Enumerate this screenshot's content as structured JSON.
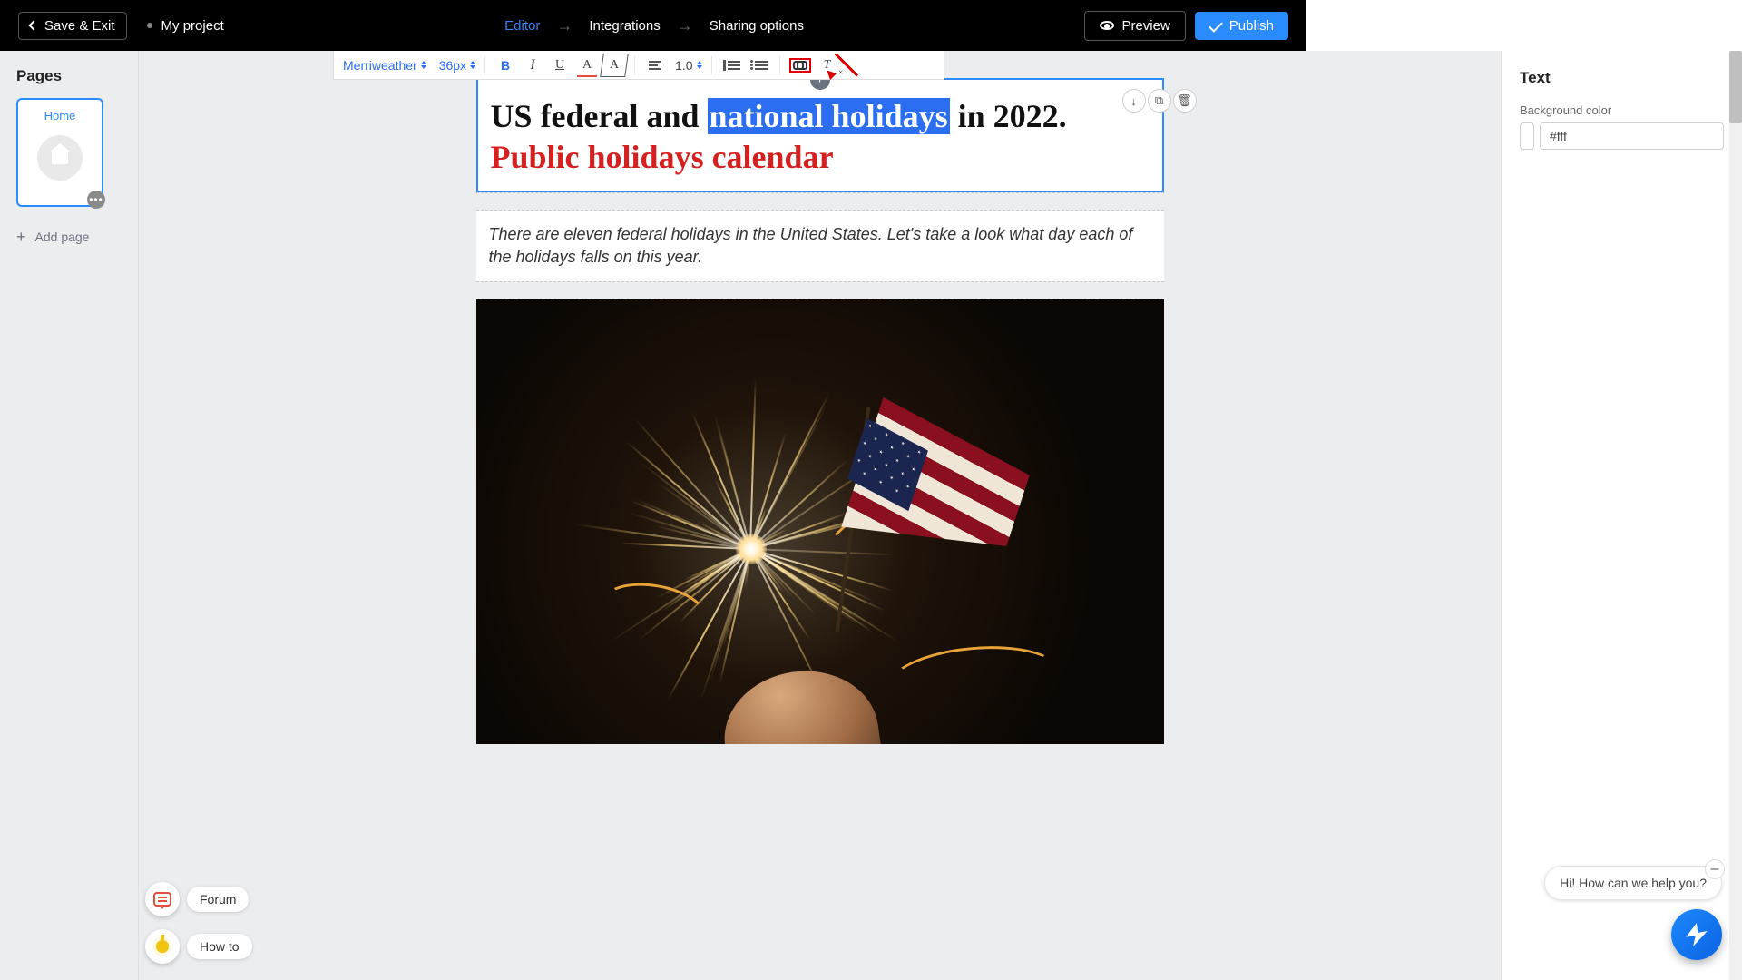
{
  "topbar": {
    "saveExit": "Save & Exit",
    "project": "My project",
    "nav": {
      "editor": "Editor",
      "integrations": "Integrations",
      "sharing": "Sharing options"
    },
    "preview": "Preview",
    "publish": "Publish"
  },
  "rtToolbar": {
    "font": "Merriweather",
    "size": "36px",
    "lineHeight": "1.0"
  },
  "leftbar": {
    "title": "Pages",
    "page0": "Home",
    "addPage": "Add page"
  },
  "content": {
    "h1_pre": "US federal and ",
    "h1_sel": "national holidays",
    "h1_post": " in 2022.",
    "h1_line2": "Public holidays calendar",
    "intro": "There are eleven federal holidays in the United States. Let's take a look what day each of the holidays falls on this year."
  },
  "rightbar": {
    "title": "Text",
    "bgLabel": "Background color",
    "bgValue": "#fff"
  },
  "help": {
    "forum": "Forum",
    "howto": "How to",
    "msg": "Hi! How can we help you?"
  }
}
